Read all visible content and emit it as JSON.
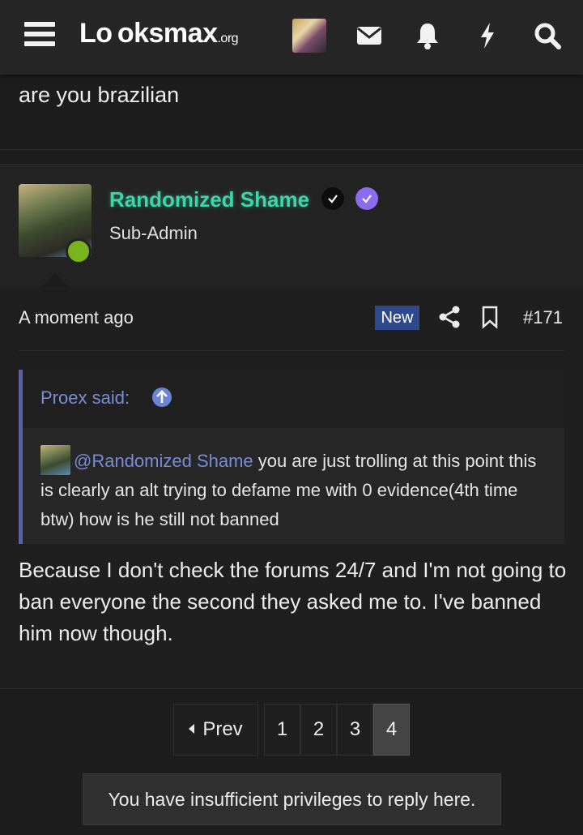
{
  "header": {
    "logo_main": "Lo oksmax",
    "logo_suffix": ".org",
    "icons": [
      "menu-icon",
      "envelope-icon",
      "bell-icon",
      "lightning-icon",
      "search-icon"
    ]
  },
  "previous_post": {
    "text": "are you brazilian"
  },
  "post": {
    "username": "Randomized Shame",
    "role": "Sub-Admin",
    "time": "A moment ago",
    "new_label": "New",
    "post_number": "#171",
    "quote": {
      "author_label": "Proex said:",
      "mention": "@Randomized Shame",
      "text": " you are just trolling at this point this is clearly an alt trying to defame me with 0 evidence(4th time btw) how is he still not banned"
    },
    "reply": "Because I don't check the forums 24/7 and I'm not going to ban everyone the second they asked me to. I've banned him now though."
  },
  "pagination": {
    "prev_label": "Prev",
    "pages": [
      "1",
      "2",
      "3",
      "4"
    ],
    "current": "4"
  },
  "notice": "You have insufficient privileges to reply here.",
  "colors": {
    "username": "#3dd6a5",
    "accent_link": "#7a8bd8",
    "new_badge": "#2f4a8c",
    "online": "#7ab41d"
  }
}
